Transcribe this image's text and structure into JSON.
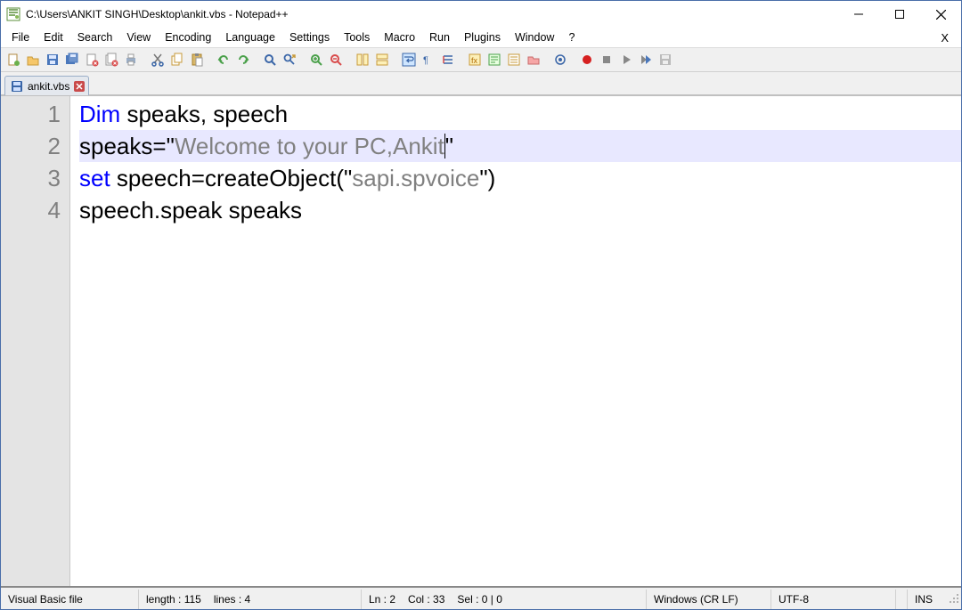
{
  "window": {
    "title": "C:\\Users\\ANKIT SINGH\\Desktop\\ankit.vbs - Notepad++",
    "minimize_label": "Minimize",
    "maximize_label": "Maximize",
    "close_label": "Close"
  },
  "menu": {
    "items": [
      "File",
      "Edit",
      "Search",
      "View",
      "Encoding",
      "Language",
      "Settings",
      "Tools",
      "Macro",
      "Run",
      "Plugins",
      "Window",
      "?"
    ],
    "close_doc_label": "X"
  },
  "toolbar_icons": [
    "new-icon",
    "open-icon",
    "save-icon",
    "save-all-icon",
    "close-icon",
    "close-all-icon",
    "print-icon",
    "sep",
    "cut-icon",
    "copy-icon",
    "paste-icon",
    "sep",
    "undo-icon",
    "redo-icon",
    "sep",
    "find-icon",
    "replace-icon",
    "sep",
    "zoom-in-icon",
    "zoom-out-icon",
    "sep",
    "sync-v-icon",
    "sync-h-icon",
    "sep",
    "wrap-icon",
    "all-chars-icon",
    "indent-guide-icon",
    "sep",
    "lang-icon",
    "doc-map-icon",
    "function-list-icon",
    "folder-icon",
    "sep",
    "monitor-icon",
    "sep",
    "record-icon",
    "stop-icon",
    "play-icon",
    "play-multi-icon",
    "save-macro-icon"
  ],
  "tab": {
    "label": "ankit.vbs",
    "close_label": "Close tab"
  },
  "code": {
    "lines": [
      {
        "n": "1",
        "tokens": [
          {
            "t": "Dim",
            "c": "kw"
          },
          {
            "t": " speaks",
            "c": "op"
          },
          {
            "t": ",",
            "c": "op"
          },
          {
            "t": " speech",
            "c": "op"
          }
        ]
      },
      {
        "n": "2",
        "current": true,
        "tokens": [
          {
            "t": "speaks",
            "c": "op"
          },
          {
            "t": "=",
            "c": "op"
          },
          {
            "t": "\"",
            "c": "op"
          },
          {
            "t": "Welcome to your PC,Ankit",
            "c": "str"
          },
          {
            "t": "",
            "caret": true
          },
          {
            "t": "\"",
            "c": "op"
          }
        ]
      },
      {
        "n": "3",
        "tokens": [
          {
            "t": "set",
            "c": "kw"
          },
          {
            "t": " speech",
            "c": "op"
          },
          {
            "t": "=",
            "c": "op"
          },
          {
            "t": "createObject",
            "c": "op"
          },
          {
            "t": "(",
            "c": "op"
          },
          {
            "t": "\"",
            "c": "op"
          },
          {
            "t": "sapi.spvoice",
            "c": "str"
          },
          {
            "t": "\"",
            "c": "op"
          },
          {
            "t": ")",
            "c": "op"
          }
        ]
      },
      {
        "n": "4",
        "tokens": [
          {
            "t": "speech.speak speaks",
            "c": "op"
          }
        ]
      }
    ]
  },
  "status": {
    "file_type": "Visual Basic file",
    "length": "length : 115",
    "lines": "lines : 4",
    "ln": "Ln : 2",
    "col": "Col : 33",
    "sel": "Sel : 0 | 0",
    "eol": "Windows (CR LF)",
    "encoding": "UTF-8",
    "mode": "INS"
  }
}
